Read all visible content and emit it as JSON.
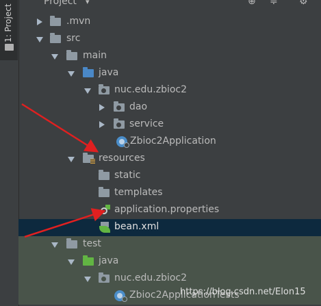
{
  "sidebar": {
    "tab_label": "1: Project"
  },
  "header": {
    "title": "Project",
    "dropdown_glyph": "▾",
    "icons": [
      "target-icon",
      "collapse-icon",
      "settings-icon"
    ]
  },
  "tree": [
    {
      "label": ".mvn",
      "icon": "folder-icon",
      "expanded": false
    },
    {
      "label": "src",
      "icon": "folder-icon",
      "expanded": true
    },
    {
      "label": "main",
      "icon": "folder-icon",
      "expanded": true
    },
    {
      "label": "java",
      "icon": "source-folder-icon",
      "expanded": true
    },
    {
      "label": "nuc.edu.zbioc2",
      "icon": "package-icon",
      "expanded": true
    },
    {
      "label": "dao",
      "icon": "package-icon",
      "expanded": false
    },
    {
      "label": "service",
      "icon": "package-icon",
      "expanded": false
    },
    {
      "label": "Zbioc2Application",
      "icon": "spring-boot-class-icon"
    },
    {
      "label": "resources",
      "icon": "resources-folder-icon",
      "expanded": true
    },
    {
      "label": "static",
      "icon": "folder-icon"
    },
    {
      "label": "templates",
      "icon": "folder-icon"
    },
    {
      "label": "application.properties",
      "icon": "properties-file-icon"
    },
    {
      "label": "bean.xml",
      "icon": "spring-xml-icon",
      "selected": true
    },
    {
      "label": "test",
      "icon": "folder-icon",
      "expanded": true
    },
    {
      "label": "java",
      "icon": "test-source-folder-icon",
      "expanded": true
    },
    {
      "label": "nuc.edu.zbioc2",
      "icon": "package-icon",
      "expanded": true
    },
    {
      "label": "Zbioc2ApplicationTests",
      "icon": "spring-boot-class-icon"
    }
  ],
  "watermark": "https://blog.csdn.net/Elon15",
  "colors": {
    "background": "#3c3f41",
    "selection": "#0d293e",
    "test_highlight": "#49544a",
    "annotation_arrow": "#e02020"
  }
}
